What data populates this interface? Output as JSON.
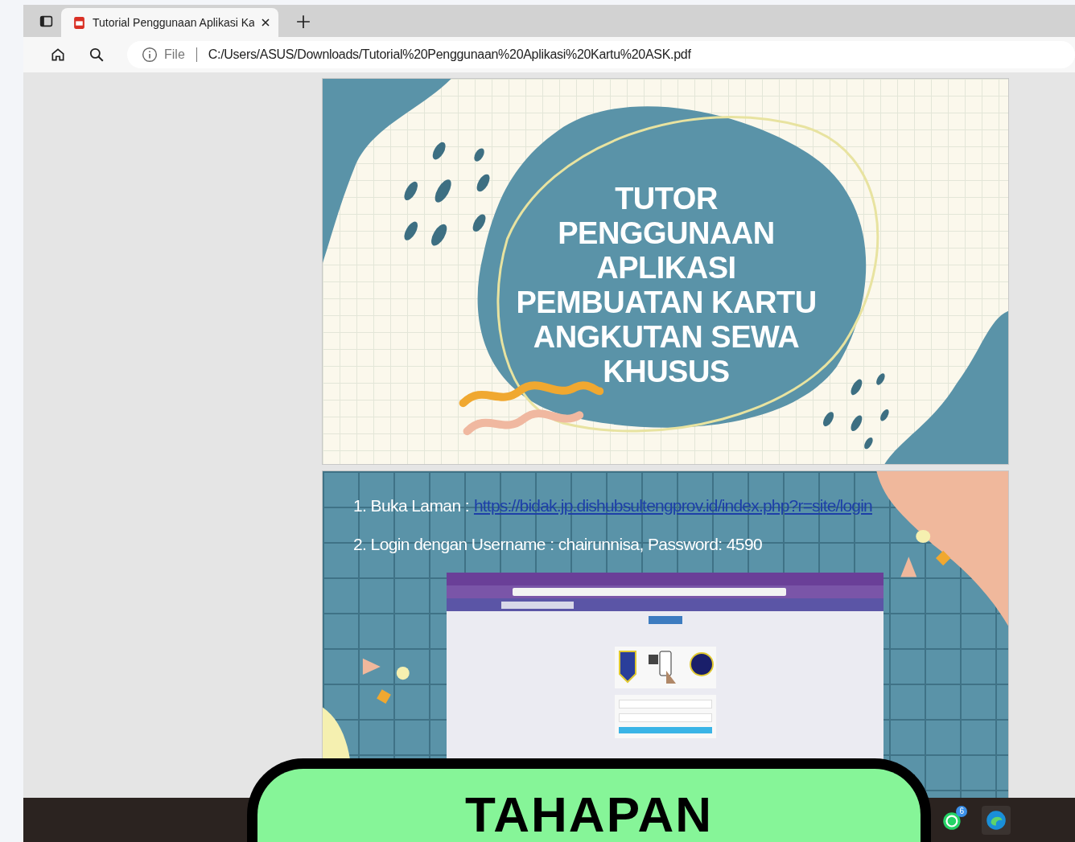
{
  "browser": {
    "tab": {
      "title": "Tutorial Penggunaan Aplikasi Ka",
      "selected": true
    },
    "address": {
      "scheme_label": "File",
      "url": "C:/Users/ASUS/Downloads/Tutorial%20Penggunaan%20Aplikasi%20Kartu%20ASK.pdf"
    }
  },
  "slides": [
    {
      "kind": "title",
      "title_lines": [
        "TUTOR",
        "PENGGUNAAN",
        "APLIKASI",
        "PEMBUATAN KARTU",
        "ANGKUTAN SEWA",
        "KHUSUS"
      ]
    },
    {
      "kind": "steps",
      "steps": [
        {
          "text": "1. Buka Laman :",
          "link": "https://bidak.jp.dishubsultengprov.id/index.php?r=site/login"
        },
        {
          "text": "2. Login dengan Username : chairunnisa, Password: 4590"
        }
      ]
    }
  ],
  "taskbar": {
    "whatsapp_badge": "6"
  },
  "banner": {
    "title": "TAHAPAN"
  }
}
